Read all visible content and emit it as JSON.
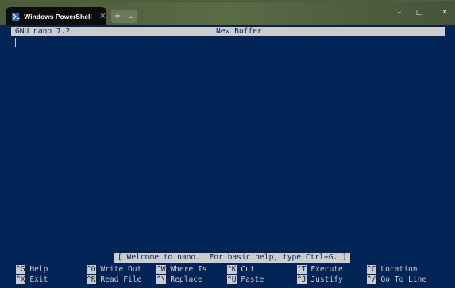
{
  "window": {
    "tab_title": "Windows PowerShell",
    "tab_close": "×",
    "new_tab": "+",
    "dropdown": "⌄",
    "minimize": "–",
    "maximize": "□",
    "close": "✕"
  },
  "nano": {
    "version": "GNU nano 7.2",
    "buffer": "New Buffer",
    "status_message": "[ Welcome to nano.  For basic help, type Ctrl+G. ]",
    "shortcuts_row1": [
      {
        "key": "^G",
        "label": " Help"
      },
      {
        "key": "^O",
        "label": " Write Out"
      },
      {
        "key": "^W",
        "label": " Where Is"
      },
      {
        "key": "^K",
        "label": " Cut"
      },
      {
        "key": "^T",
        "label": " Execute"
      },
      {
        "key": "^C",
        "label": " Location"
      }
    ],
    "shortcuts_row2": [
      {
        "key": "^X",
        "label": " Exit"
      },
      {
        "key": "^R",
        "label": " Read File"
      },
      {
        "key": "^\\",
        "label": " Replace"
      },
      {
        "key": "^U",
        "label": " Paste"
      },
      {
        "key": "^J",
        "label": " Justify"
      },
      {
        "key": "^/",
        "label": " Go To Line"
      }
    ]
  }
}
